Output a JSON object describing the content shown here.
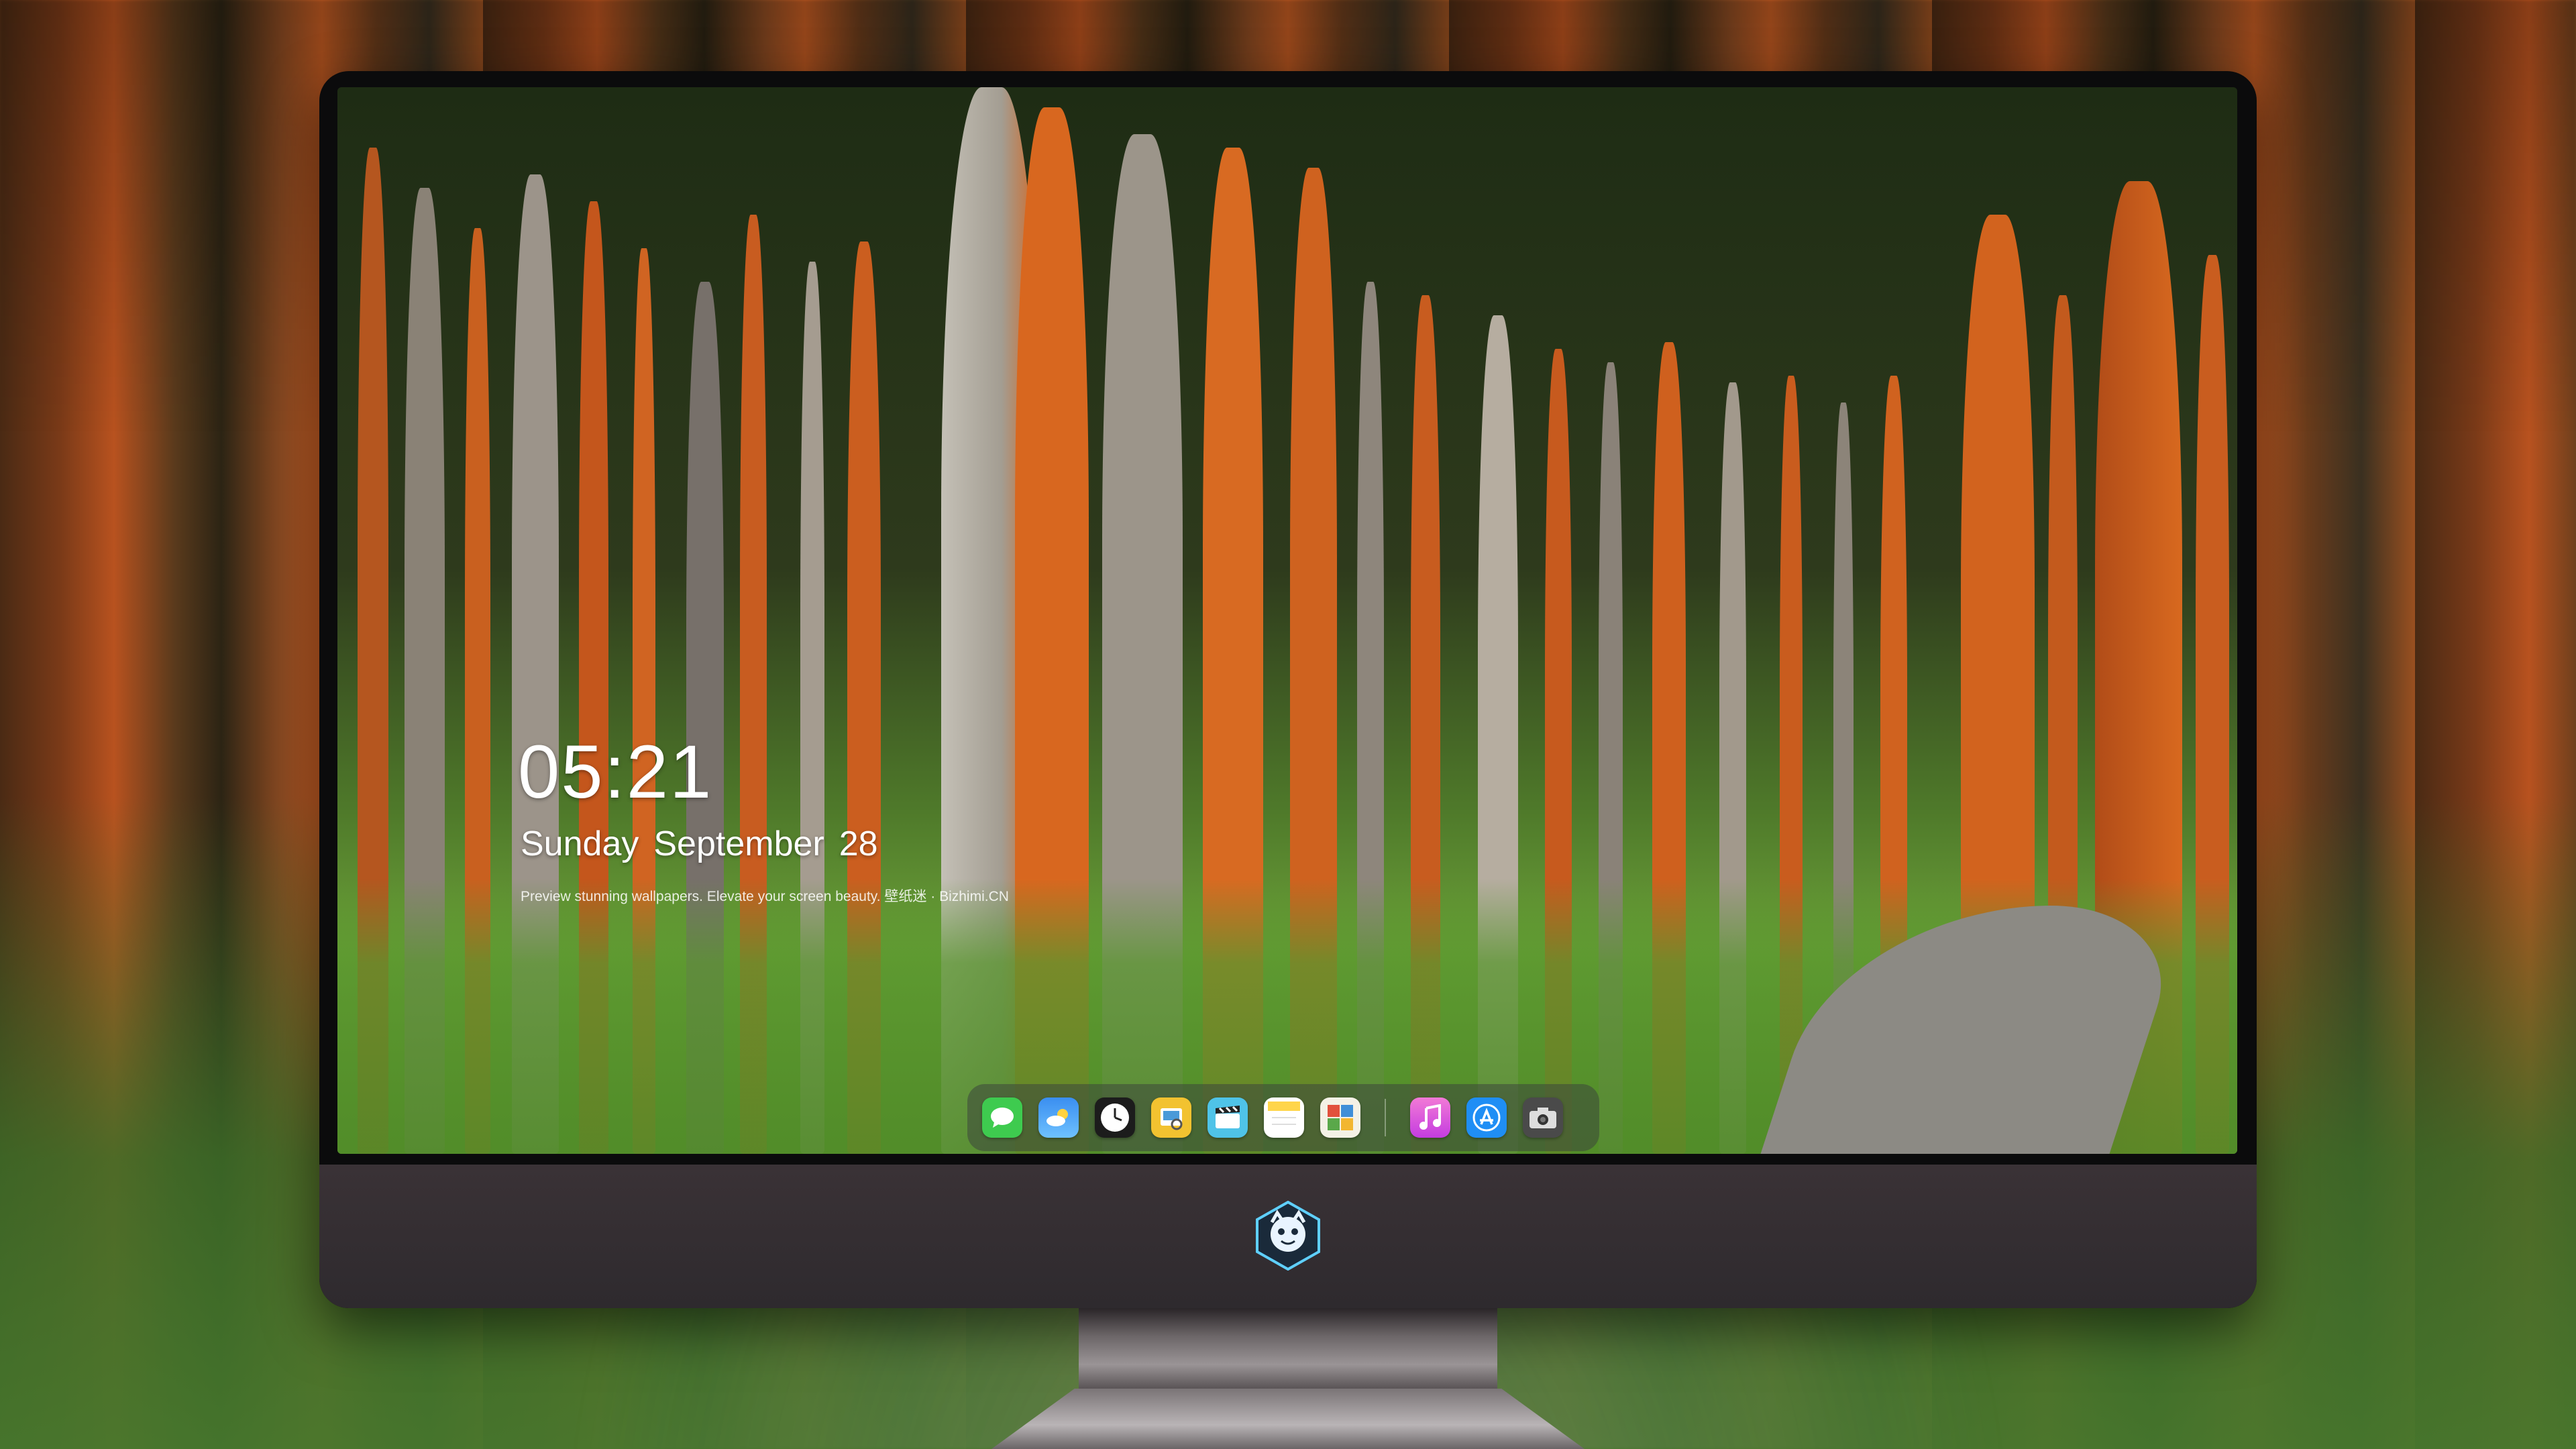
{
  "lockscreen": {
    "time": "05:21",
    "weekday": "Sunday",
    "month": "September",
    "day": "28",
    "caption": "Preview stunning wallpapers. Elevate your screen beauty. 壁纸迷 · Bizhimi.CN"
  },
  "dock": {
    "apps": [
      {
        "name": "Messages",
        "icon": "messages-icon",
        "color": "#3ecb4f"
      },
      {
        "name": "Weather",
        "icon": "weather-icon",
        "color": "#3a8ef0"
      },
      {
        "name": "Clock",
        "icon": "clock-icon",
        "color": "#1c1c1c"
      },
      {
        "name": "Preview",
        "icon": "preview-icon",
        "color": "#f2c230"
      },
      {
        "name": "Clips",
        "icon": "clips-icon",
        "color": "#4fc3e8"
      },
      {
        "name": "Notes",
        "icon": "notes-icon",
        "color": "#ffd54a"
      },
      {
        "name": "Photo Booth",
        "icon": "photos-icon",
        "color": "#5aa84a"
      },
      {
        "name": "Music",
        "icon": "music-icon",
        "color": "#e04bd0"
      },
      {
        "name": "App Store",
        "icon": "app-store-icon",
        "color": "#1f8ef5"
      },
      {
        "name": "Camera",
        "icon": "camera-icon",
        "color": "#4a4a4a"
      }
    ]
  },
  "colors": {
    "monitor_bezel": "#0b0b0c",
    "monitor_chin": "#3a3236",
    "accent_bark": "#c05a22"
  }
}
